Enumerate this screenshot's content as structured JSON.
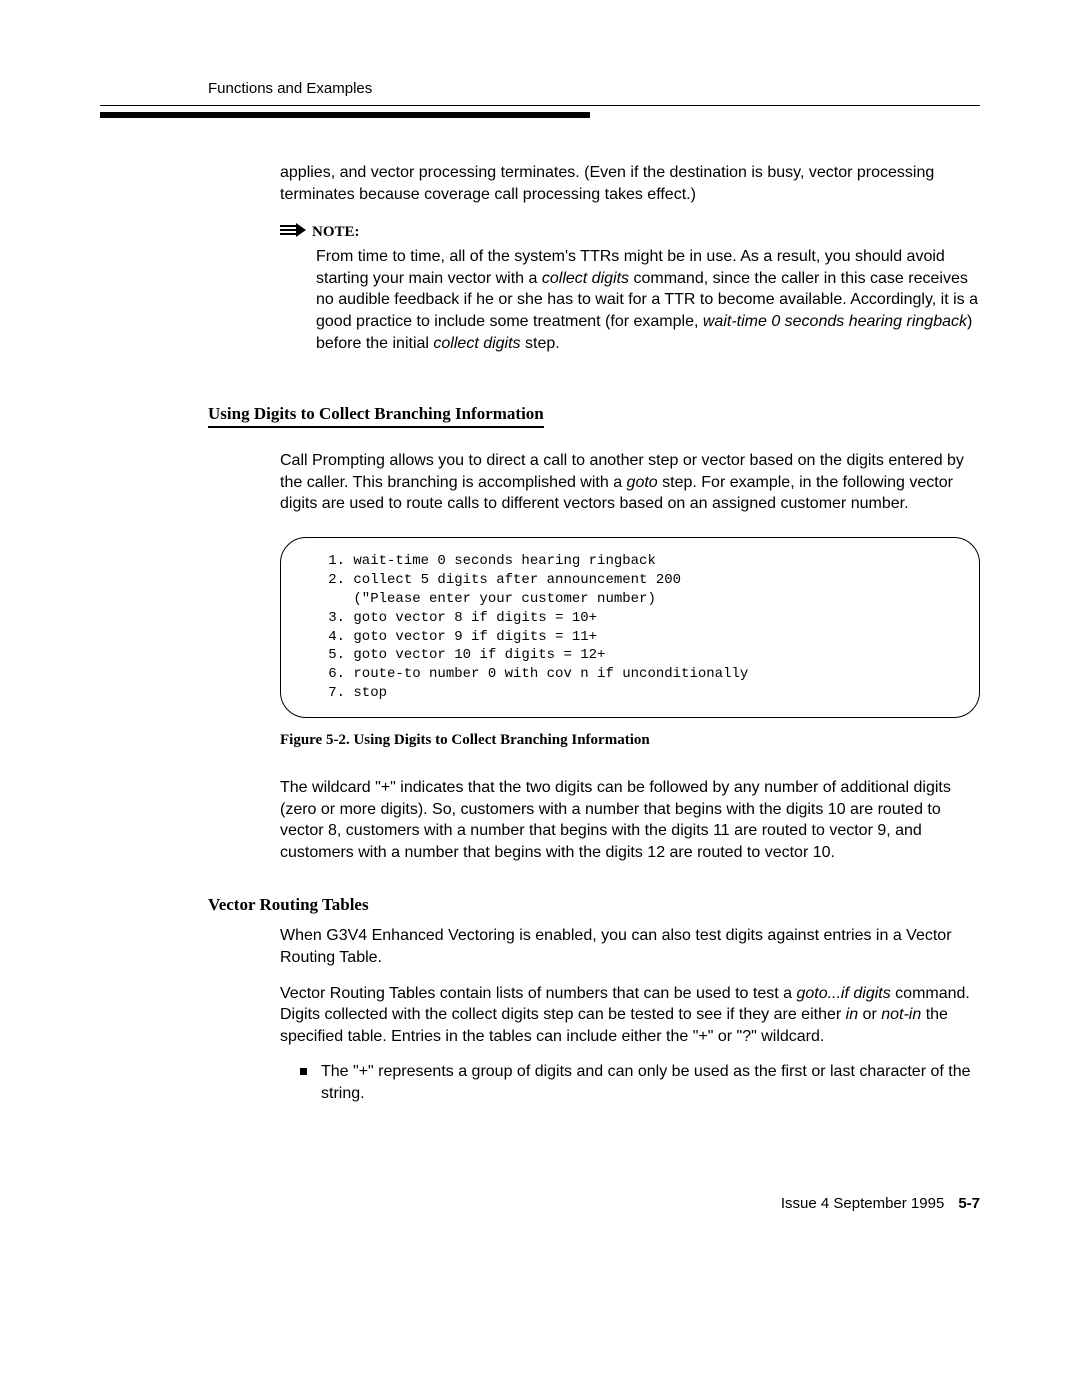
{
  "running_head": "Functions and Examples",
  "para_applies": "applies, and vector processing terminates.  (Even if the destination is busy, vector processing terminates because coverage call processing takes effect.)",
  "note_label": "NOTE:",
  "note_1a": "From time to time, all of the system's TTRs might be in use. As a result, you should avoid starting your main vector with a ",
  "note_1_ital1": "collect digits",
  "note_1b": " command, since the caller in this case receives no audible feedback if he or she has to wait for a TTR to become available.  Accordingly, it is a good practice to include some treatment (for example, ",
  "note_1_ital2": "wait-time 0 seconds hearing ringback",
  "note_1c": ") before the initial ",
  "note_1_ital3": "collect digits",
  "note_1d": " step.",
  "section1_title": "Using Digits to Collect Branching Information",
  "sec1_p1a": "Call Prompting allows you to direct a call to another step or vector based on the digits entered by the caller. This branching is accomplished with a ",
  "sec1_p1_ital": "goto",
  "sec1_p1b": " step. For example, in the following vector digits are used to route calls to different vectors based on an assigned customer number.",
  "code_text": "   1. wait-time 0 seconds hearing ringback\n   2. collect 5 digits after announcement 200\n      (\"Please enter your customer number)\n   3. goto vector 8 if digits = 10+\n   4. goto vector 9 if digits = 11+\n   5. goto vector 10 if digits = 12+\n   6. route-to number 0 with cov n if unconditionally\n   7. stop",
  "fig_caption": "Figure 5-2.   Using Digits to Collect Branching Information",
  "sec1_p2": "The wildcard \"+\" indicates that the two digits can be followed by any number of additional digits (zero or more digits). So, customers with a number that begins with the digits 10 are routed to vector 8, customers with a number that begins with the digits 11 are routed to vector 9, and customers with a number that begins with the digits 12 are routed to vector 10.",
  "section2_title": "Vector Routing Tables",
  "sec2_p1": "When G3V4 Enhanced Vectoring is enabled, you can also test digits against entries in a Vector Routing Table.",
  "sec2_p2a": "Vector Routing Tables contain lists of numbers that can be used to test a ",
  "sec2_p2_ital1": "goto...if digits",
  "sec2_p2b": " command. Digits collected with the collect digits step can be tested to see if they are either ",
  "sec2_p2_ital2": "in",
  "sec2_p2c": " or ",
  "sec2_p2_ital3": "not-in",
  "sec2_p2d": " the specified table. Entries in the tables can include either the \"+\" or \"?\" wildcard.",
  "bullet1": "The \"+\" represents a group of digits and can only be used as the first or last character of the string.",
  "footer_issue": "Issue 4 September 1995",
  "footer_page": "5-7"
}
